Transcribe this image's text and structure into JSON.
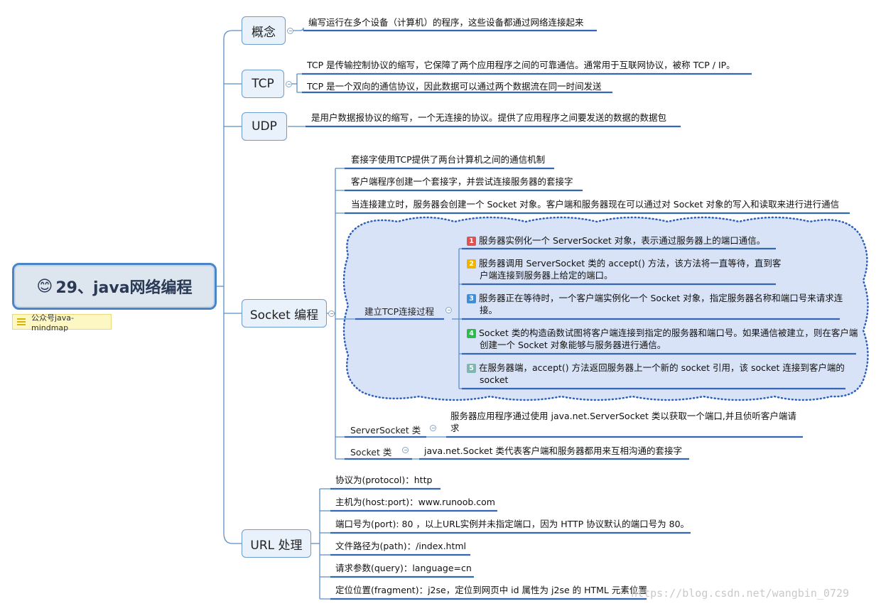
{
  "root": {
    "emoji": "😊",
    "title": "29、java网络编程"
  },
  "note": "公众号java-mindmap",
  "branches": {
    "concept": {
      "label": "概念",
      "items": [
        "编写运行在多个设备（计算机）的程序，这些设备都通过网络连接起来"
      ]
    },
    "tcp": {
      "label": "TCP",
      "items": [
        "TCP 是传输控制协议的缩写，它保障了两个应用程序之间的可靠通信。通常用于互联网协议，被称 TCP / IP。",
        "TCP 是一个双向的通信协议，因此数据可以通过两个数据流在同一时间发送"
      ]
    },
    "udp": {
      "label": "UDP",
      "items": [
        "是用户数据报协议的缩写，一个无连接的协议。提供了应用程序之间要发送的数据的数据包"
      ]
    },
    "socket": {
      "label": "Socket 编程",
      "items": [
        "套接字使用TCP提供了两台计算机之间的通信机制",
        "客户端程序创建一个套接字，并尝试连接服务器的套接字",
        "当连接建立时，服务器会创建一个 Socket 对象。客户端和服务器现在可以通过对 Socket 对象的写入和读取来进行进行通信"
      ],
      "tcp_process": {
        "label": "建立TCP连接过程",
        "steps": [
          {
            "num": "1",
            "color": "#e05252",
            "text": "服务器实例化一个 ServerSocket 对象，表示通过服务器上的端口通信。"
          },
          {
            "num": "2",
            "color": "#f0b400",
            "text": "服务器调用 ServerSocket 类的 accept() 方法，该方法将一直等待，直到客户端连接到服务器上给定的端口。"
          },
          {
            "num": "3",
            "color": "#3f8fd8",
            "text": "服务器正在等待时，一个客户端实例化一个 Socket 对象，指定服务器名称和端口号来请求连接。"
          },
          {
            "num": "4",
            "color": "#2dbb4e",
            "text": "Socket 类的构造函数试图将客户端连接到指定的服务器和端口号。如果通信被建立，则在客户端创建一个 Socket 对象能够与服务器进行通信。"
          },
          {
            "num": "5",
            "color": "#7fb6b0",
            "text": "在服务器端，accept() 方法返回服务器上一个新的 socket 引用，该 socket 连接到客户端的 socket"
          }
        ]
      },
      "server_socket": {
        "label": "ServerSocket 类",
        "text": "服务器应用程序通过使用 java.net.ServerSocket 类以获取一个端口,并且侦听客户端请求"
      },
      "socket_class": {
        "label": "Socket 类",
        "text": "java.net.Socket 类代表客户端和服务器都用来互相沟通的套接字"
      }
    },
    "url": {
      "label": "URL 处理",
      "items": [
        "协议为(protocol)：http",
        "主机为(host:port)：www.runoob.com",
        "端口号为(port): 80 ，以上URL实例并未指定端口，因为 HTTP 协议默认的端口号为 80。",
        "文件路径为(path)：/index.html",
        "请求参数(query)：language=cn",
        "定位位置(fragment)：j2se，定位到网页中 id 属性为 j2se 的 HTML 元素位置"
      ]
    }
  },
  "watermark": "https://blog.csdn.net/wangbin_0729",
  "colors": {
    "line": "#5b8ec8",
    "branch_border": "#6d9ccf",
    "cloud_fill": "#d9e3f7",
    "cloud_border": "#2d5fbf"
  }
}
